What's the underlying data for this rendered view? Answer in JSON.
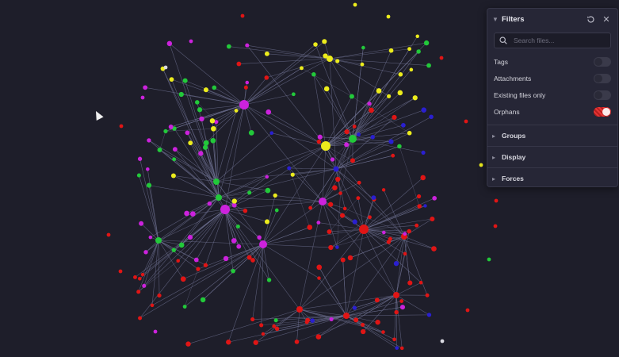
{
  "panel": {
    "title": "Filters",
    "search": {
      "placeholder": "Search files...",
      "value": ""
    },
    "toggles": [
      {
        "label": "Tags",
        "on": false
      },
      {
        "label": "Attachments",
        "on": false
      },
      {
        "label": "Existing files only",
        "on": false
      },
      {
        "label": "Orphans",
        "on": true
      }
    ],
    "sections": [
      "Groups",
      "Display",
      "Forces"
    ]
  },
  "icons": {
    "collapse": "chevron-down-icon",
    "expand": "chevron-right-icon",
    "reset": "reset-icon",
    "close": "close-icon",
    "search": "search-icon"
  },
  "colors": {
    "background": "#1e1e2a",
    "edge": "#6e7090",
    "yellow": "#ecec1c",
    "green": "#22c93a",
    "magenta": "#cc22dd",
    "red": "#e01515",
    "blue": "#2a1fd0",
    "gray": "#d8d8e0",
    "toggle_on": "#e53535"
  }
}
